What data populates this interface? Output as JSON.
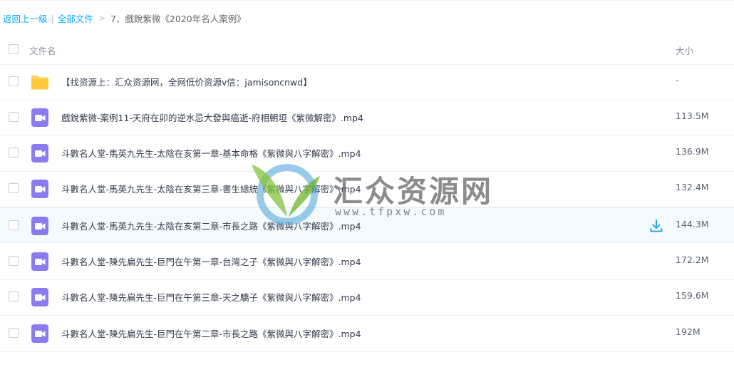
{
  "breadcrumb": {
    "back": "返回上一级",
    "separator": "|",
    "all_files": "全部文件",
    "arrow": ">",
    "current": "7、戲銳紫微《2020年名人案例》"
  },
  "header": {
    "name_label": "文件名",
    "size_label": "大小"
  },
  "rows": [
    {
      "type": "folder-icon",
      "name": "【找资源上：汇众资源网，全网低价资源v信：jamisoncnwd】",
      "size": "-"
    },
    {
      "type": "video-icon",
      "name": "戲銳紫微-案例11-天府在卯的逆水忌大發與癌逝-府相朝垣《紫微解密》.mp4",
      "size": "113.5M"
    },
    {
      "type": "video-icon",
      "name": "斗數名人堂-馬英九先生-太陰在亥第一章-基本命格《紫微與八字解密》.mp4",
      "size": "136.9M"
    },
    {
      "type": "video-icon",
      "name": "斗數名人堂-馬英九先生-太陰在亥第三章-書生總統《紫微與八字解密》.mp4",
      "size": "132.4M"
    },
    {
      "type": "video-icon",
      "name": "斗數名人堂-馬英九先生-太陰在亥第二章-市長之路《紫微與八字解密》.mp4",
      "size": "144.3M",
      "hover": true,
      "action": "download-icon"
    },
    {
      "type": "video-icon",
      "name": "斗數名人堂-陳先扁先生-巨門在午第一章-台灣之子《紫微與八字解密》.mp4",
      "size": "172.2M"
    },
    {
      "type": "video-icon",
      "name": "斗數名人堂-陳先扁先生-巨門在午第三章-天之驕子《紫微與八字解密》.mp4",
      "size": "159.6M"
    },
    {
      "type": "video-icon",
      "name": "斗數名人堂-陳先扁先生-巨門在午第二章-市長之路《紫微與八字解密》.mp4",
      "size": "192M"
    }
  ],
  "watermark": {
    "title": "汇众资源网",
    "url": "www.tfpxw.com"
  },
  "colors": {
    "link": "#09aaff",
    "folder": "#ffd35c",
    "video": "#8a7cf0",
    "hover_row": "#f4fbff",
    "download": "#2aa7e4"
  }
}
